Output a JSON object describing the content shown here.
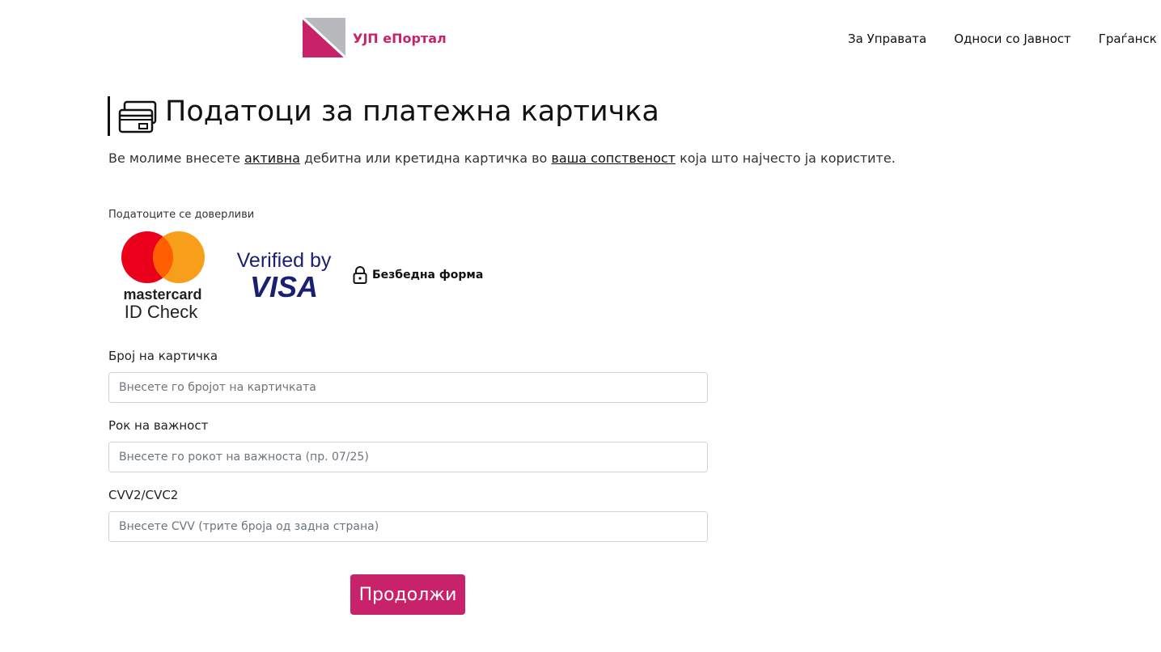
{
  "header": {
    "brand": "УЈП еПортал",
    "nav": [
      "За Управата",
      "Односи со Јавност",
      "Граѓанск"
    ]
  },
  "page": {
    "title": "Податоци за платежна картичка",
    "intro": {
      "part1": "Ве молиме внесете ",
      "link1": "активна",
      "part2": " дебитна или кретидна картичка во ",
      "link2": "ваша сопственост",
      "part3": " која што најчесто ја користите."
    },
    "trusted_label": "Податоците се доверливи",
    "mastercard": {
      "brand": "mastercard",
      "sub": "ID Check"
    },
    "visa": {
      "line1": "Verified by",
      "line2": "VISA"
    },
    "secure_label": "Безбедна форма"
  },
  "form": {
    "card_number": {
      "label": "Број на картичка",
      "placeholder": "Внесете го бројот на картичката"
    },
    "expiry": {
      "label": "Рок на важност",
      "placeholder": "Внесете го рокот на важноста (пр. 07/25)"
    },
    "cvv": {
      "label": "CVV2/CVC2",
      "placeholder": "Внесете CVV (трите броја од задна страна)"
    },
    "submit_label": "Продолжи"
  },
  "colors": {
    "brand": "#c8236a",
    "logo_gray": "#b7b9bc",
    "mc_red": "#eb001b",
    "mc_orange": "#f79e1b",
    "visa_navy": "#1a1f71"
  }
}
